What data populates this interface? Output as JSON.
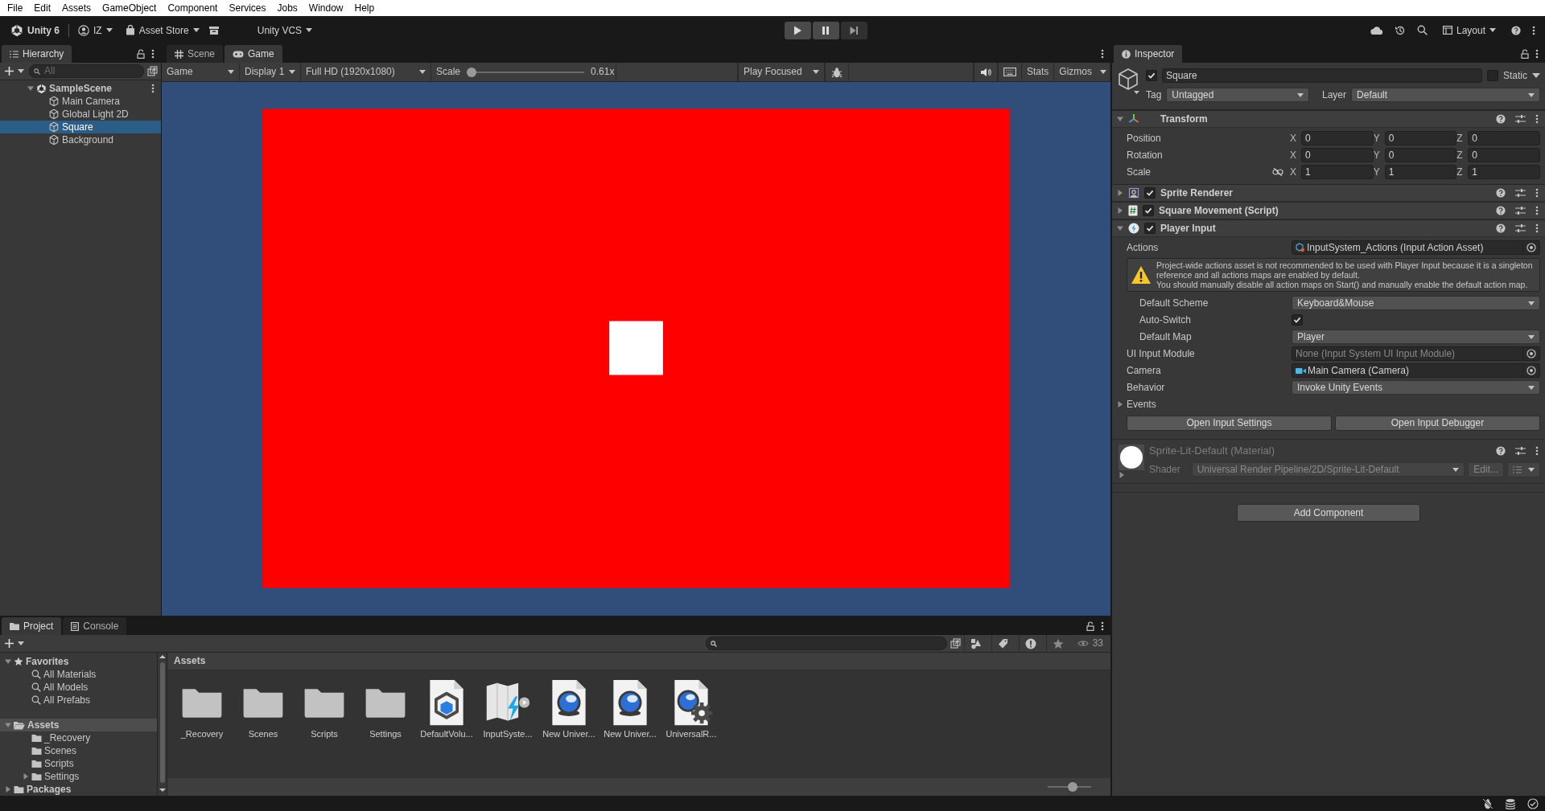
{
  "menu_bar": [
    "File",
    "Edit",
    "Assets",
    "GameObject",
    "Component",
    "Services",
    "Jobs",
    "Window",
    "Help"
  ],
  "toolbar": {
    "product": "Unity 6",
    "account": "IZ",
    "asset_store": "Asset Store",
    "version_control": "Unity VCS",
    "layout": "Layout"
  },
  "hierarchy": {
    "tabs": [
      {
        "label": "Hierarchy",
        "selected": true
      }
    ],
    "search_placeholder": "All",
    "scene": {
      "label": "SampleScene",
      "expanded": true,
      "selected": false,
      "children": [
        {
          "label": "Main Camera",
          "selected": false
        },
        {
          "label": "Global Light 2D",
          "selected": false
        },
        {
          "label": "Square",
          "selected": true
        },
        {
          "label": "Background",
          "selected": false
        }
      ]
    }
  },
  "view_tabs": [
    {
      "label": "Scene",
      "kind": "scene",
      "selected": false
    },
    {
      "label": "Game",
      "kind": "game",
      "selected": true
    }
  ],
  "game_toolbar": {
    "view": "Game",
    "display": "Display 1",
    "resolution": "Full HD (1920x1080)",
    "scale_label": "Scale",
    "scale": {
      "level": 0
    },
    "scale_reading": "0.61x",
    "play_mode": "Play Focused",
    "stats": "Stats",
    "gizmos": "Gizmos"
  },
  "inspector": {
    "tabs": [
      {
        "label": "Inspector",
        "selected": true
      }
    ],
    "object": {
      "active": true,
      "name": "Square",
      "static": false,
      "static_label": "Static",
      "tag_label": "Tag",
      "tag": "Untagged",
      "layer_label": "Layer",
      "layer": "Default"
    },
    "components": [
      {
        "kind": "transform",
        "title": "Transform",
        "expanded": true,
        "rows": [
          {
            "label": "Position",
            "values": [
              {
                "axis": "X",
                "value": "0"
              },
              {
                "axis": "Y",
                "value": "0"
              },
              {
                "axis": "Z",
                "value": "0"
              }
            ]
          },
          {
            "label": "Rotation",
            "values": [
              {
                "axis": "X",
                "value": "0"
              },
              {
                "axis": "Y",
                "value": "0"
              },
              {
                "axis": "Z",
                "value": "0"
              }
            ]
          },
          {
            "label": "Scale",
            "linked": false,
            "values": [
              {
                "axis": "X",
                "value": "1"
              },
              {
                "axis": "Y",
                "value": "1"
              },
              {
                "axis": "Z",
                "value": "1"
              }
            ]
          }
        ]
      },
      {
        "kind": "sprite_renderer",
        "title": "Sprite Renderer",
        "enabled": true,
        "expanded": false
      },
      {
        "kind": "script",
        "title": "Square Movement (Script)",
        "enabled": true,
        "expanded": false
      },
      {
        "kind": "player_input",
        "title": "Player Input",
        "enabled": true,
        "expanded": true,
        "fields": [
          {
            "kind": "asset_ref",
            "label": "Actions",
            "value": "InputSystem_Actions (Input Action Asset)",
            "warning": "Project-wide actions asset is not recommended to be used with Player Input because it is a singleton reference and all actions maps are enabled by default.\nYou should manually disable all action maps on Start() and manually enable the default action map.",
            "children": [
              {
                "kind": "dropdown",
                "label": "Default Scheme",
                "value": "Keyboard&Mouse"
              },
              {
                "kind": "toggle",
                "label": "Auto-Switch",
                "checked": true
              },
              {
                "kind": "dropdown",
                "label": "Default Map",
                "value": "Player"
              }
            ]
          },
          {
            "kind": "empty_ref",
            "label": "UI Input Module",
            "value": "None (Input System UI Input Module)"
          },
          {
            "kind": "camera_ref",
            "label": "Camera",
            "value": "Main Camera (Camera)"
          },
          {
            "kind": "dropdown",
            "label": "Behavior",
            "value": "Invoke Unity Events"
          },
          {
            "kind": "foldout",
            "label": "Events",
            "expanded": false
          }
        ],
        "buttons": [
          "Open Input Settings",
          "Open Input Debugger"
        ]
      }
    ],
    "material": {
      "title": "Sprite-Lit-Default (Material)",
      "shader_label": "Shader",
      "shader": "Universal Render Pipeline/2D/Sprite-Lit-Default",
      "edit": "Edit...",
      "expanded": false
    },
    "add_component": "Add Component"
  },
  "project": {
    "tabs": [
      {
        "label": "Project",
        "kind": "project",
        "selected": true
      },
      {
        "label": "Console",
        "kind": "console",
        "selected": false
      }
    ],
    "hidden_count": "33",
    "tree": [
      {
        "label": "Favorites",
        "kind": "favorites",
        "expanded": true,
        "selected": false,
        "children": [
          {
            "label": "All Materials",
            "kind": "search",
            "selected": false
          },
          {
            "label": "All Models",
            "kind": "search",
            "selected": false
          },
          {
            "label": "All Prefabs",
            "kind": "search",
            "selected": false
          }
        ]
      },
      {
        "label": "Assets",
        "kind": "folder",
        "expanded": true,
        "selected": true,
        "children": [
          {
            "label": "_Recovery",
            "kind": "folder",
            "selected": false
          },
          {
            "label": "Scenes",
            "kind": "folder",
            "selected": false
          },
          {
            "label": "Scripts",
            "kind": "folder",
            "selected": false
          },
          {
            "label": "Settings",
            "kind": "folder",
            "expanded": false,
            "selected": false
          }
        ]
      },
      {
        "label": "Packages",
        "kind": "folder",
        "expanded": false,
        "selected": false
      }
    ],
    "breadcrumb": "Assets",
    "assets": [
      {
        "label": "_Recovery",
        "kind": "folder"
      },
      {
        "label": "Scenes",
        "kind": "folder"
      },
      {
        "label": "Scripts",
        "kind": "folder"
      },
      {
        "label": "Settings",
        "kind": "folder"
      },
      {
        "label": "DefaultVolu...",
        "kind": "volume_profile"
      },
      {
        "label": "InputSyste...",
        "kind": "input_actions"
      },
      {
        "label": "New Univer...",
        "kind": "pipeline_asset"
      },
      {
        "label": "New Univer...",
        "kind": "pipeline_asset"
      },
      {
        "label": "UniversalR...",
        "kind": "pipeline_settings"
      }
    ],
    "zoom": {
      "level": 0.6
    }
  }
}
